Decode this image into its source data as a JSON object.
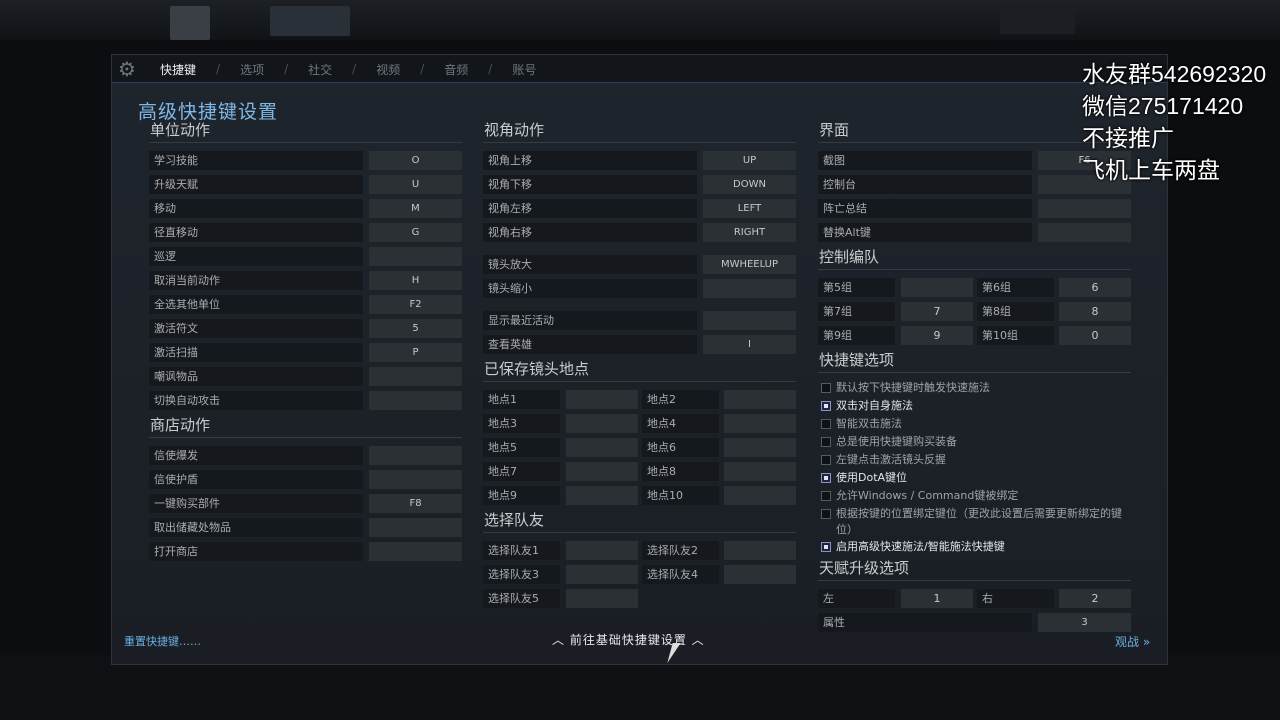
{
  "tabs": [
    "快捷键",
    "选项",
    "社交",
    "视频",
    "音频",
    "账号"
  ],
  "page_title": "高级快捷键设置",
  "unit_actions": {
    "title": "单位动作",
    "rows": [
      {
        "label": "学习技能",
        "key": "O"
      },
      {
        "label": "升级天赋",
        "key": "U"
      },
      {
        "label": "移动",
        "key": "M"
      },
      {
        "label": "径直移动",
        "key": "G"
      },
      {
        "label": "巡逻",
        "key": ""
      },
      {
        "label": "取消当前动作",
        "key": "H"
      },
      {
        "label": "全选其他单位",
        "key": "F2"
      },
      {
        "label": "激活符文",
        "key": "5"
      },
      {
        "label": "激活扫描",
        "key": "P"
      },
      {
        "label": "嘲讽物品",
        "key": ""
      },
      {
        "label": "切换自动攻击",
        "key": ""
      }
    ]
  },
  "shop_actions": {
    "title": "商店动作",
    "rows": [
      {
        "label": "信使爆发",
        "key": ""
      },
      {
        "label": "信使护盾",
        "key": ""
      },
      {
        "label": "一键购买部件",
        "key": "F8"
      },
      {
        "label": "取出储藏处物品",
        "key": ""
      },
      {
        "label": "打开商店",
        "key": ""
      }
    ]
  },
  "camera_actions": {
    "title": "视角动作",
    "rows_a": [
      {
        "label": "视角上移",
        "key": "UP"
      },
      {
        "label": "视角下移",
        "key": "DOWN"
      },
      {
        "label": "视角左移",
        "key": "LEFT"
      },
      {
        "label": "视角右移",
        "key": "RIGHT"
      }
    ],
    "rows_b": [
      {
        "label": "镜头放大",
        "key": "MWHEELUP"
      },
      {
        "label": "镜头缩小",
        "key": ""
      }
    ],
    "rows_c": [
      {
        "label": "显示最近活动",
        "key": ""
      },
      {
        "label": "查看英雄",
        "key": "I"
      }
    ]
  },
  "saved_camera": {
    "title": "已保存镜头地点",
    "rows": [
      {
        "l1": "地点1",
        "k1": "",
        "l2": "地点2",
        "k2": ""
      },
      {
        "l1": "地点3",
        "k1": "",
        "l2": "地点4",
        "k2": ""
      },
      {
        "l1": "地点5",
        "k1": "",
        "l2": "地点6",
        "k2": ""
      },
      {
        "l1": "地点7",
        "k1": "",
        "l2": "地点8",
        "k2": ""
      },
      {
        "l1": "地点9",
        "k1": "",
        "l2": "地点10",
        "k2": ""
      }
    ]
  },
  "select_ally": {
    "title": "选择队友",
    "rows": [
      {
        "l1": "选择队友1",
        "k1": "",
        "l2": "选择队友2",
        "k2": ""
      },
      {
        "l1": "选择队友3",
        "k1": "",
        "l2": "选择队友4",
        "k2": ""
      }
    ],
    "last": {
      "l1": "选择队友5",
      "k1": ""
    }
  },
  "interface": {
    "title": "界面",
    "rows": [
      {
        "label": "截图",
        "key": "F6"
      },
      {
        "label": "控制台",
        "key": ""
      },
      {
        "label": "阵亡总结",
        "key": ""
      },
      {
        "label": "替换Alt键",
        "key": ""
      }
    ]
  },
  "control_groups": {
    "title": "控制编队",
    "rows": [
      {
        "l1": "第5组",
        "k1": "",
        "l2": "第6组",
        "k2": "6"
      },
      {
        "l1": "第7组",
        "k1": "7",
        "l2": "第8组",
        "k2": "8"
      },
      {
        "l1": "第9组",
        "k1": "9",
        "l2": "第10组",
        "k2": "0"
      }
    ]
  },
  "hotkey_options": {
    "title": "快捷键选项",
    "items": [
      {
        "label": "默认按下快捷键时触发快速施法",
        "checked": false
      },
      {
        "label": "双击对自身施法",
        "checked": true
      },
      {
        "label": "智能双击施法",
        "checked": false
      },
      {
        "label": "总是使用快捷键购买装备",
        "checked": false
      },
      {
        "label": "左键点击激活镜头反握",
        "checked": false
      },
      {
        "label": "使用DotA键位",
        "checked": true
      },
      {
        "label": "允许Windows / Command键被绑定",
        "checked": false
      },
      {
        "label": "根据按键的位置绑定键位（更改此设置后需要更新绑定的键位）",
        "checked": false
      },
      {
        "label": "启用高级快速施法/智能施法快捷键",
        "checked": true
      }
    ]
  },
  "talent_options": {
    "title": "天赋升级选项",
    "row": {
      "l1": "左",
      "k1": "1",
      "l2": "右",
      "k2": "2"
    },
    "attr": {
      "label": "属性",
      "key": "3"
    }
  },
  "footer": {
    "reset": "重置快捷键……",
    "basic": "前往基础快捷键设置",
    "spectate": "观战 »"
  },
  "overlay": [
    "水友群542692320",
    "微信275171420",
    "不接推广",
    "飞机上车两盘"
  ],
  "colors": {
    "accent": "#7fb8e8",
    "link": "#6aaee0",
    "panel": "#1d2229",
    "key_bg": "#2b3035"
  }
}
